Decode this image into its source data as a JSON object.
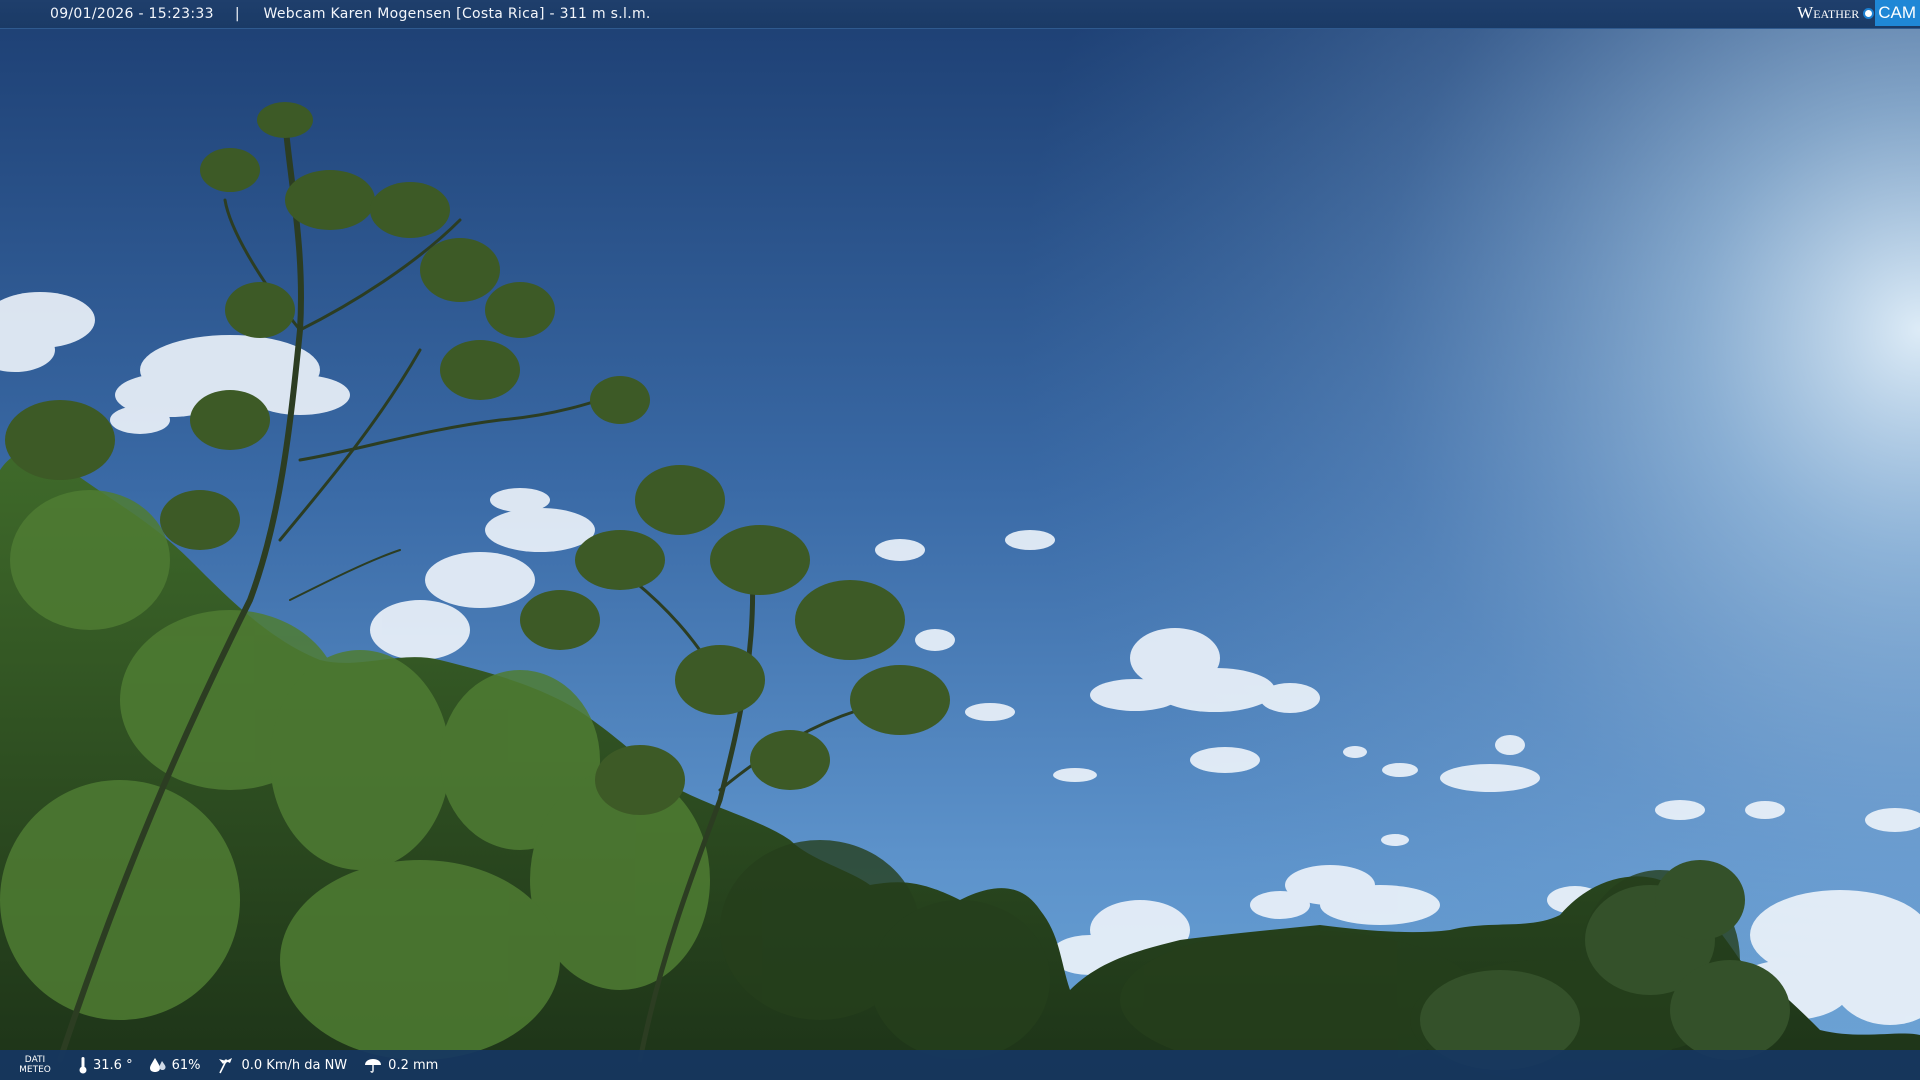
{
  "topbar": {
    "timestamp": "09/01/2026 - 15:23:33",
    "separator": "|",
    "title": "Webcam Karen Mogensen [Costa Rica] - 311 m s.l.m.",
    "logo_weather": "Weather",
    "logo_cam": "CAM"
  },
  "bottombar": {
    "label_line1": "DATI",
    "label_line2": "METEO",
    "temperature": "31.6 °",
    "temperature_icon": "thermometer-icon",
    "humidity": "61%",
    "humidity_icon": "humidity-icon",
    "wind": "0.0 Km/h da NW",
    "wind_icon": "wind-icon",
    "rain": "0.2 mm",
    "rain_icon": "rain-icon"
  },
  "colors": {
    "bar_background": "#1a3a66",
    "logo_accent": "#1f87d6",
    "sky_top": "#1d3f73",
    "sky_sunlit": "#cfe6f7"
  }
}
